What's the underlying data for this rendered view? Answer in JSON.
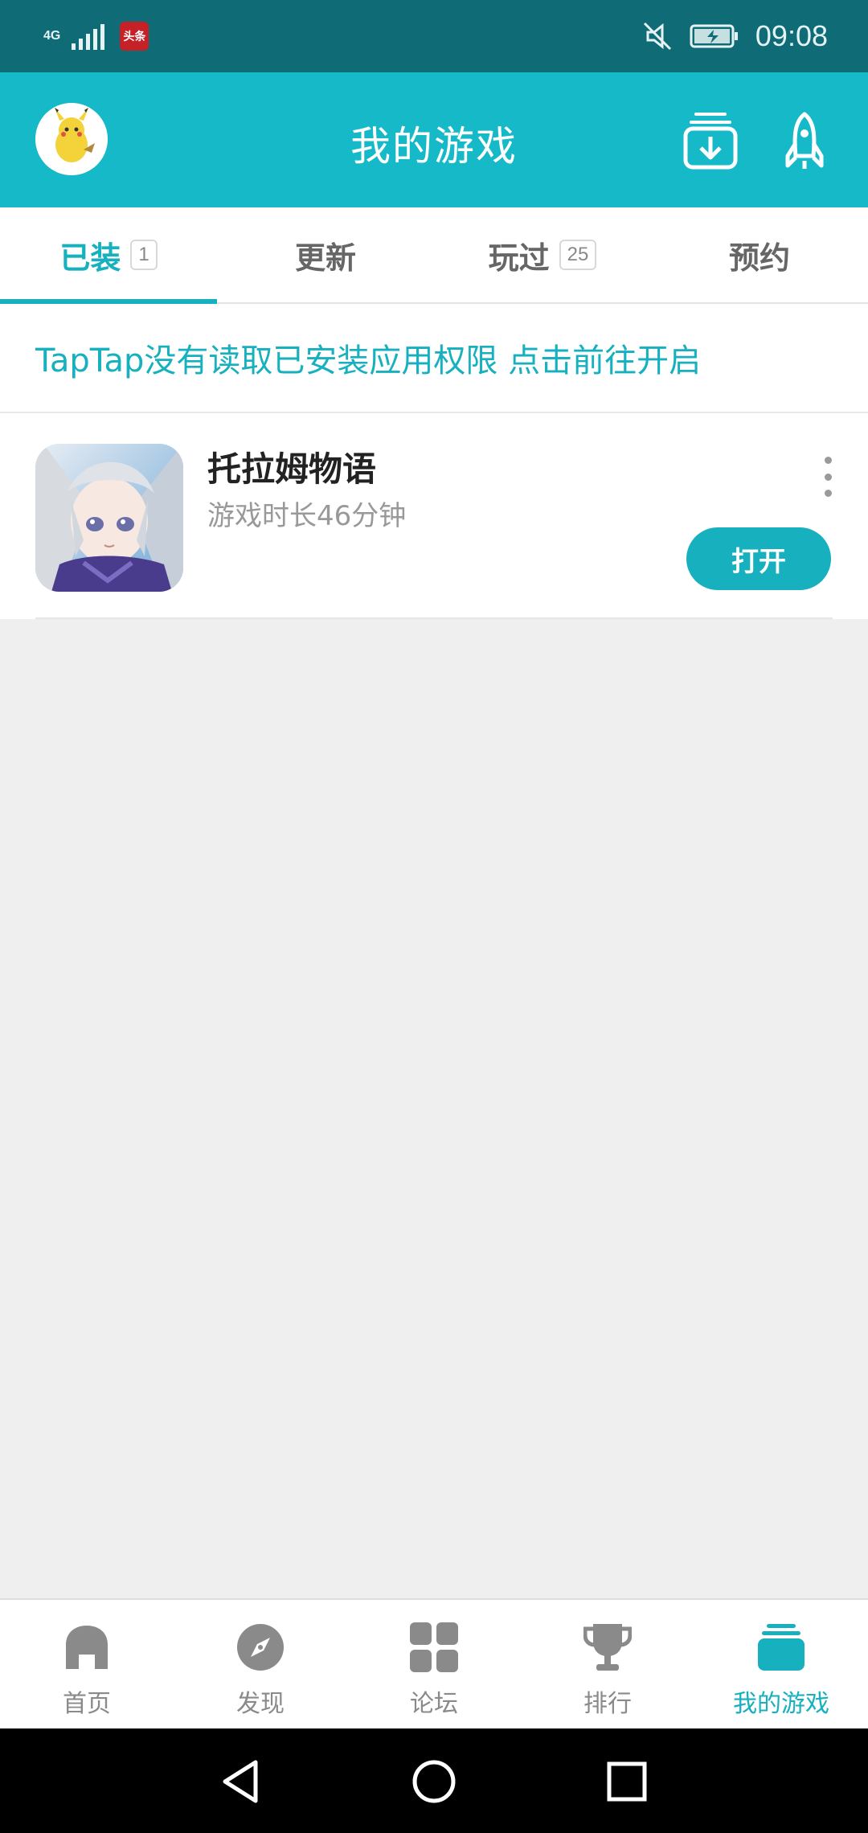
{
  "status_bar": {
    "network": "4G",
    "notification_app": "头条",
    "time": "09:08"
  },
  "header": {
    "title": "我的游戏",
    "icons": [
      "avatar",
      "download-icon",
      "rocket-icon"
    ]
  },
  "tabs": [
    {
      "label": "已装",
      "badge": "1",
      "active": true
    },
    {
      "label": "更新",
      "badge": null,
      "active": false
    },
    {
      "label": "玩过",
      "badge": "25",
      "active": false
    },
    {
      "label": "预约",
      "badge": null,
      "active": false
    }
  ],
  "notice": {
    "text": "TapTap没有读取已安装应用权限 点击前往开启"
  },
  "games": [
    {
      "title": "托拉姆物语",
      "subtitle": "游戏时长46分钟",
      "action_label": "打开"
    }
  ],
  "bottom_nav": [
    {
      "label": "首页",
      "icon": "home-icon",
      "active": false
    },
    {
      "label": "发现",
      "icon": "compass-icon",
      "active": false
    },
    {
      "label": "论坛",
      "icon": "grid-icon",
      "active": false
    },
    {
      "label": "排行",
      "icon": "trophy-icon",
      "active": false
    },
    {
      "label": "我的游戏",
      "icon": "stack-icon",
      "active": true
    }
  ],
  "colors": {
    "accent": "#16b9c8",
    "status_bar": "#0f6b76",
    "background": "#efefef"
  }
}
